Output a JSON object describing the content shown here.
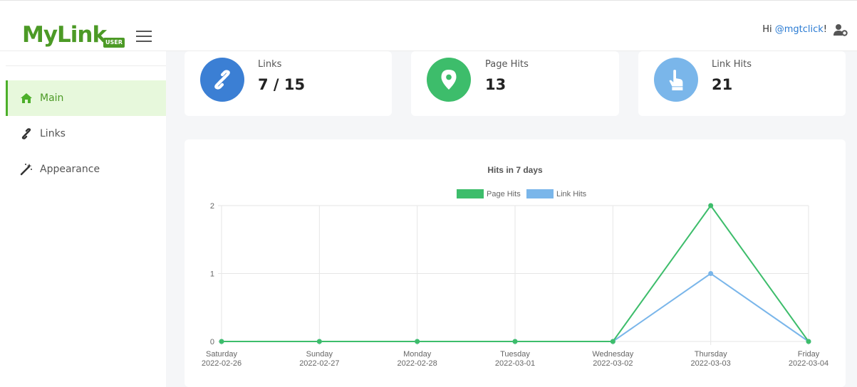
{
  "brand": {
    "logo_text": "MyLink",
    "badge": "USER"
  },
  "header": {
    "greeting_prefix": "Hi ",
    "username": "@mgtclick",
    "greeting_suffix": "!"
  },
  "sidebar": {
    "items": [
      {
        "label": "Main",
        "icon": "home-icon",
        "active": true
      },
      {
        "label": "Links",
        "icon": "link-icon",
        "active": false
      },
      {
        "label": "Appearance",
        "icon": "magic-wand-icon",
        "active": false
      }
    ]
  },
  "stats": [
    {
      "label": "Links",
      "value": "7 / 15",
      "icon": "link-icon",
      "color": "#3b7fd4"
    },
    {
      "label": "Page Hits",
      "value": "13",
      "icon": "map-marker-icon",
      "color": "#3dbd6b"
    },
    {
      "label": "Link Hits",
      "value": "21",
      "icon": "hand-pointer-icon",
      "color": "#7ab6ea"
    }
  ],
  "colors": {
    "accent": "#4c9a26",
    "page_hits": "#3dbd6b",
    "link_hits": "#7ab6ea"
  },
  "chart_data": {
    "type": "line",
    "title": "Hits in 7 days",
    "x": [
      [
        "Saturday",
        "2022-02-26"
      ],
      [
        "Sunday",
        "2022-02-27"
      ],
      [
        "Monday",
        "2022-02-28"
      ],
      [
        "Tuesday",
        "2022-03-01"
      ],
      [
        "Wednesday",
        "2022-03-02"
      ],
      [
        "Thursday",
        "2022-03-03"
      ],
      [
        "Friday",
        "2022-03-04"
      ]
    ],
    "series": [
      {
        "name": "Page Hits",
        "color": "#3dbd6b",
        "values": [
          0,
          0,
          0,
          0,
          0,
          2,
          0
        ]
      },
      {
        "name": "Link Hits",
        "color": "#7ab6ea",
        "values": [
          0,
          0,
          0,
          0,
          0,
          1,
          0
        ]
      }
    ],
    "ylim": [
      0,
      2
    ],
    "yticks": [
      0,
      1,
      2
    ],
    "grid": true,
    "legend": "top"
  }
}
